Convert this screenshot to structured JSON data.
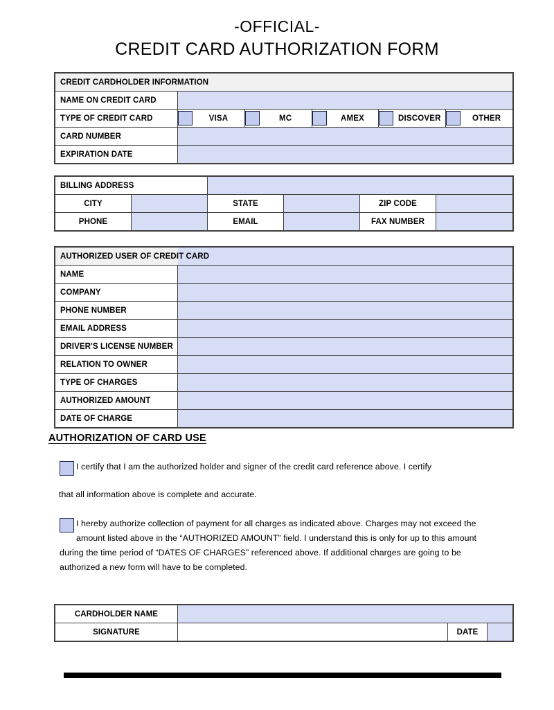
{
  "document": {
    "title_line1": "-OFFICIAL-",
    "title_line2": "CREDIT CARD AUTHORIZATION FORM"
  },
  "colors": {
    "field_fill": "#d8ddf6",
    "header_fill": "#f1f1f1",
    "checkbox_fill": "#c3cdf0",
    "checkbox_border": "#16214a",
    "border": "#3f3f3f",
    "rule": "#000000"
  },
  "cardholder_section": {
    "header": "CREDIT CARDHOLDER INFORMATION",
    "rows": [
      {
        "label": "NAME  ON  CREDIT CARD",
        "value": ""
      },
      {
        "label": "TYPE OF  CREDIT CARD",
        "value": ""
      },
      {
        "label": "CARD NUMBER",
        "value": ""
      },
      {
        "label": "EXPIRATION DATE",
        "value": ""
      }
    ],
    "card_types": [
      {
        "name": "VISA",
        "checked": false
      },
      {
        "name": "MC",
        "checked": false
      },
      {
        "name": "AMEX",
        "checked": false
      },
      {
        "name": "DISCOVER",
        "checked": false
      },
      {
        "name": "OTHER",
        "checked": false
      }
    ]
  },
  "billing_section": {
    "address_label": "BILLING ADDRESS",
    "address_value": "",
    "grid": [
      [
        {
          "label": "CITY",
          "value": ""
        },
        {
          "label": "STATE",
          "value": ""
        },
        {
          "label": "ZIP CODE",
          "value": ""
        }
      ],
      [
        {
          "label": "PHONE",
          "value": ""
        },
        {
          "label": "EMAIL",
          "value": ""
        },
        {
          "label": "FAX NUMBER",
          "value": ""
        }
      ]
    ]
  },
  "authorized_user_section": {
    "header": "AUTHORIZED USER OF CREDIT CARD",
    "rows": [
      {
        "label": "NAME",
        "value": ""
      },
      {
        "label": "COMPANY",
        "value": ""
      },
      {
        "label": "PHONE NUMBER",
        "value": ""
      },
      {
        "label": "EMAIL ADDRESS",
        "value": ""
      },
      {
        "label": "DRIVER'S LICENSE NUMBER",
        "value": ""
      },
      {
        "label": "RELATION TO OWNER",
        "value": ""
      },
      {
        "label": "TYPE OF CHARGES",
        "value": ""
      },
      {
        "label": "AUTHORIZED AMOUNT",
        "value": ""
      },
      {
        "label": "DATE OF CHARGE",
        "value": ""
      }
    ]
  },
  "authorization_section": {
    "heading": "AUTHORIZATION OF CARD USE",
    "clause_1": {
      "checked": false,
      "line_1": "I certify that  I am the  authorized holder and signer of the  credit card reference  above. I certify",
      "line_2": "that  all information above is complete and accurate."
    },
    "clause_2": {
      "checked": false,
      "text": "I hereby  authorize collection of payment  for all charges as indicated above. Charges may not exceed  the amount  listed above in the  “AUTHORIZED AMOUNT” field.  I understand  this is only for up to this amount  during the  time period of “DATES OF CHARGES” referenced  above. If additional charges are going to be authorized a new form will have to be completed."
    }
  },
  "signature_section": {
    "rows": [
      {
        "label": "CARDHOLDER NAME",
        "value": ""
      },
      {
        "label": "SIGNATURE",
        "value": "",
        "date_label": "DATE",
        "date_value": ""
      }
    ]
  }
}
